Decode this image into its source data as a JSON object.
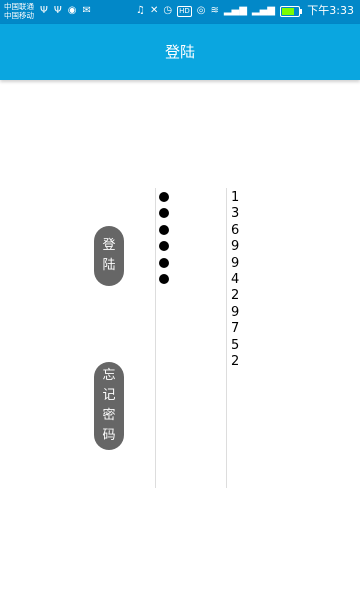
{
  "status_bar": {
    "carrier_1": "中国联通",
    "carrier_2": "中国移动",
    "time": "下午3:33",
    "hd_badge": "HD",
    "icons_left": [
      "usb-icon",
      "usb-icon",
      "notification-icon",
      "mail-icon"
    ],
    "icons_right": [
      "headset-icon",
      "mute-icon",
      "alarm-icon",
      "hd-icon",
      "eye-icon",
      "wifi-icon",
      "signal-icon",
      "signal-icon",
      "battery-icon"
    ]
  },
  "app_bar": {
    "title": "登陆"
  },
  "buttons": {
    "login": [
      "登",
      "陆"
    ],
    "forgot_password": [
      "忘",
      "记",
      "密",
      "码"
    ]
  },
  "password_field": {
    "dot_count": 6
  },
  "digit_column": {
    "digits": [
      "1",
      "3",
      "6",
      "9",
      "9",
      "4",
      "2",
      "9",
      "7",
      "5",
      "2"
    ]
  }
}
